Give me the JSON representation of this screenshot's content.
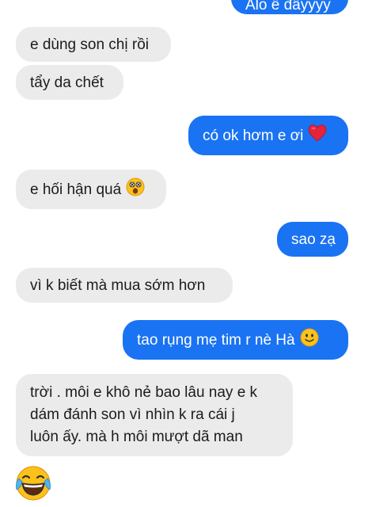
{
  "messages": [
    {
      "side": "out",
      "text": "Alo ê đâyyyy"
    },
    {
      "side": "in",
      "text": "e dùng son chị rồi"
    },
    {
      "side": "in",
      "text": "tẩy da chết"
    },
    {
      "side": "out",
      "text": "có ok hơm e ơi",
      "emoji": "red-heart"
    },
    {
      "side": "in",
      "text": "e hối hận quá",
      "emoji": "astonished-face"
    },
    {
      "side": "out",
      "text": "sao zạ"
    },
    {
      "side": "in",
      "text": "vì k biết mà mua sớm hơn"
    },
    {
      "side": "out",
      "text": "tao rụng mẹ tim r nè Hà",
      "emoji": "slightly-smiling-face"
    },
    {
      "side": "in",
      "lines": [
        "trời . môi e khô nẻ bao lâu nay e k",
        "dám đánh son vì nhìn k ra cái j",
        "luôn ấy. mà h môi mượt dã man"
      ]
    },
    {
      "side": "in",
      "emoji_only": "face-with-tears-of-joy"
    }
  ],
  "colors": {
    "incoming_bubble": "#ebebeb",
    "outgoing_bubble": "#1a73f2",
    "incoming_text": "#1c1c1c",
    "outgoing_text": "#ffffff"
  }
}
